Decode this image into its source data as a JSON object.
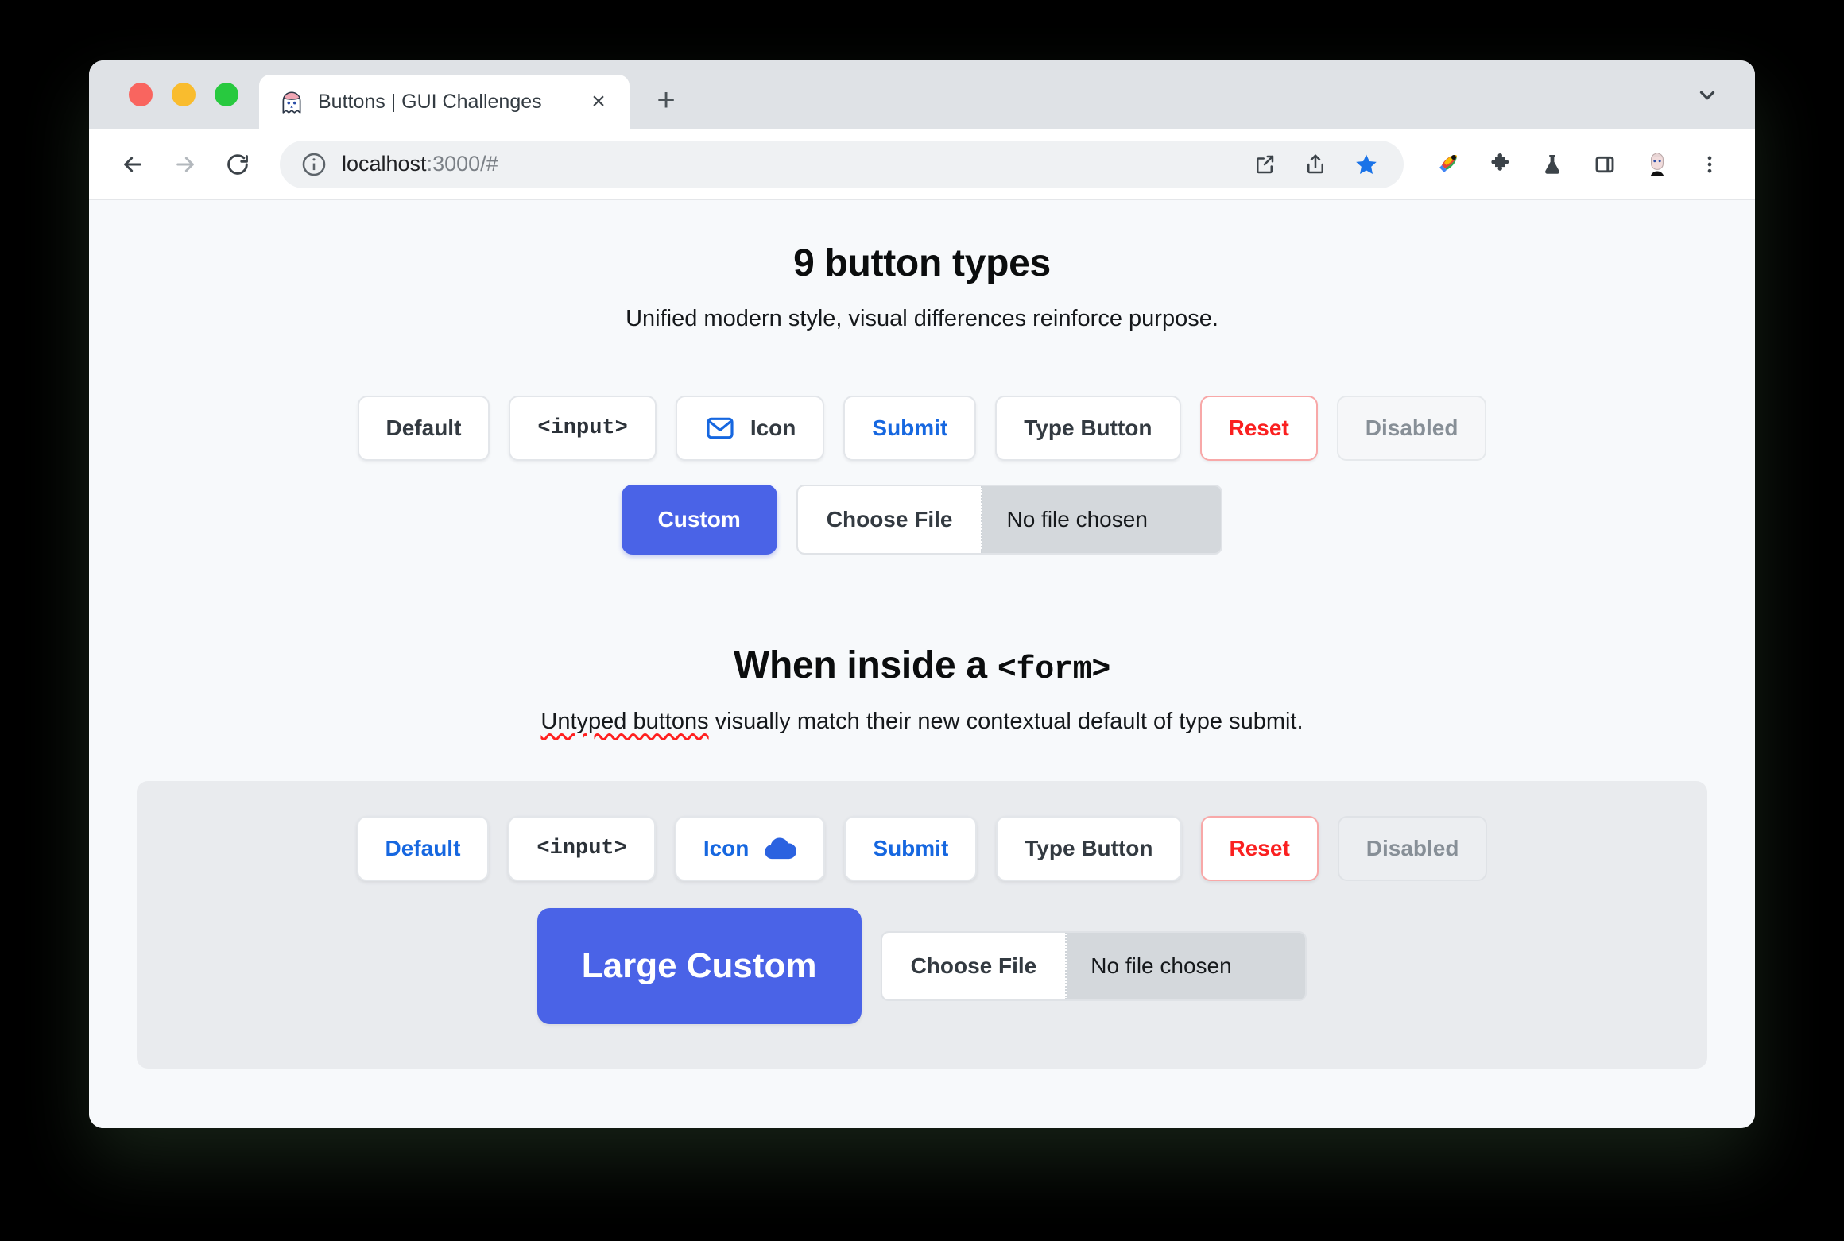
{
  "browser": {
    "tab": {
      "title": "Buttons | GUI Challenges",
      "favicon": "ghost-favicon",
      "close_label": "×"
    },
    "new_tab_label": "+",
    "omnibox": {
      "url_main": "localhost",
      "url_dim": ":3000/#",
      "info_icon": "info-circle-icon"
    },
    "toolbar_icons": [
      "back-arrow-icon",
      "forward-arrow-icon",
      "reload-icon",
      "open-in-new-icon",
      "share-icon",
      "bookmark-star-icon",
      "rocket-extension-icon",
      "puzzle-extension-icon",
      "flask-labs-icon",
      "side-panel-icon",
      "profile-avatar-icon",
      "more-vertical-icon"
    ],
    "colors": {
      "tab_strip": "#dfe2e6",
      "omnibox": "#eff1f3",
      "bookmark_star": "#1a73e8"
    }
  },
  "page": {
    "background": "#f7f9fb",
    "accent_blue": "#1667e0",
    "custom_blue": "#4a63e7",
    "reset_red": "#fa2020",
    "section_one": {
      "title": "9 button types",
      "subtitle": "Unified modern style, visual differences reinforce purpose.",
      "row_one": [
        {
          "label": "Default",
          "variant": "default",
          "icon": null
        },
        {
          "label": "<input>",
          "variant": "mono",
          "icon": null
        },
        {
          "label": "Icon",
          "variant": "icon",
          "icon": "mail-icon"
        },
        {
          "label": "Submit",
          "variant": "blue",
          "icon": null
        },
        {
          "label": "Type Button",
          "variant": "default",
          "icon": null
        },
        {
          "label": "Reset",
          "variant": "reset",
          "icon": null
        },
        {
          "label": "Disabled",
          "variant": "disabled",
          "icon": null
        }
      ],
      "row_two": {
        "custom_label": "Custom",
        "file": {
          "choose_label": "Choose File",
          "file_name": "No file chosen"
        }
      }
    },
    "section_two": {
      "title_prefix": "When inside a ",
      "title_tag": "<form>",
      "subtitle_spellchecked": "Untyped buttons",
      "subtitle_rest": " visually match their new contextual default of type submit.",
      "row_one": [
        {
          "label": "Default",
          "variant": "blue",
          "icon": null
        },
        {
          "label": "<input>",
          "variant": "mono",
          "icon": null
        },
        {
          "label": "Icon",
          "variant": "icon-blue",
          "icon": "cloud-icon"
        },
        {
          "label": "Submit",
          "variant": "blue",
          "icon": null
        },
        {
          "label": "Type Button",
          "variant": "default",
          "icon": null
        },
        {
          "label": "Reset",
          "variant": "reset",
          "icon": null
        },
        {
          "label": "Disabled",
          "variant": "disabled",
          "icon": null
        }
      ],
      "row_two": {
        "custom_label": "Large Custom",
        "file": {
          "choose_label": "Choose File",
          "file_name": "No file chosen"
        }
      }
    }
  }
}
